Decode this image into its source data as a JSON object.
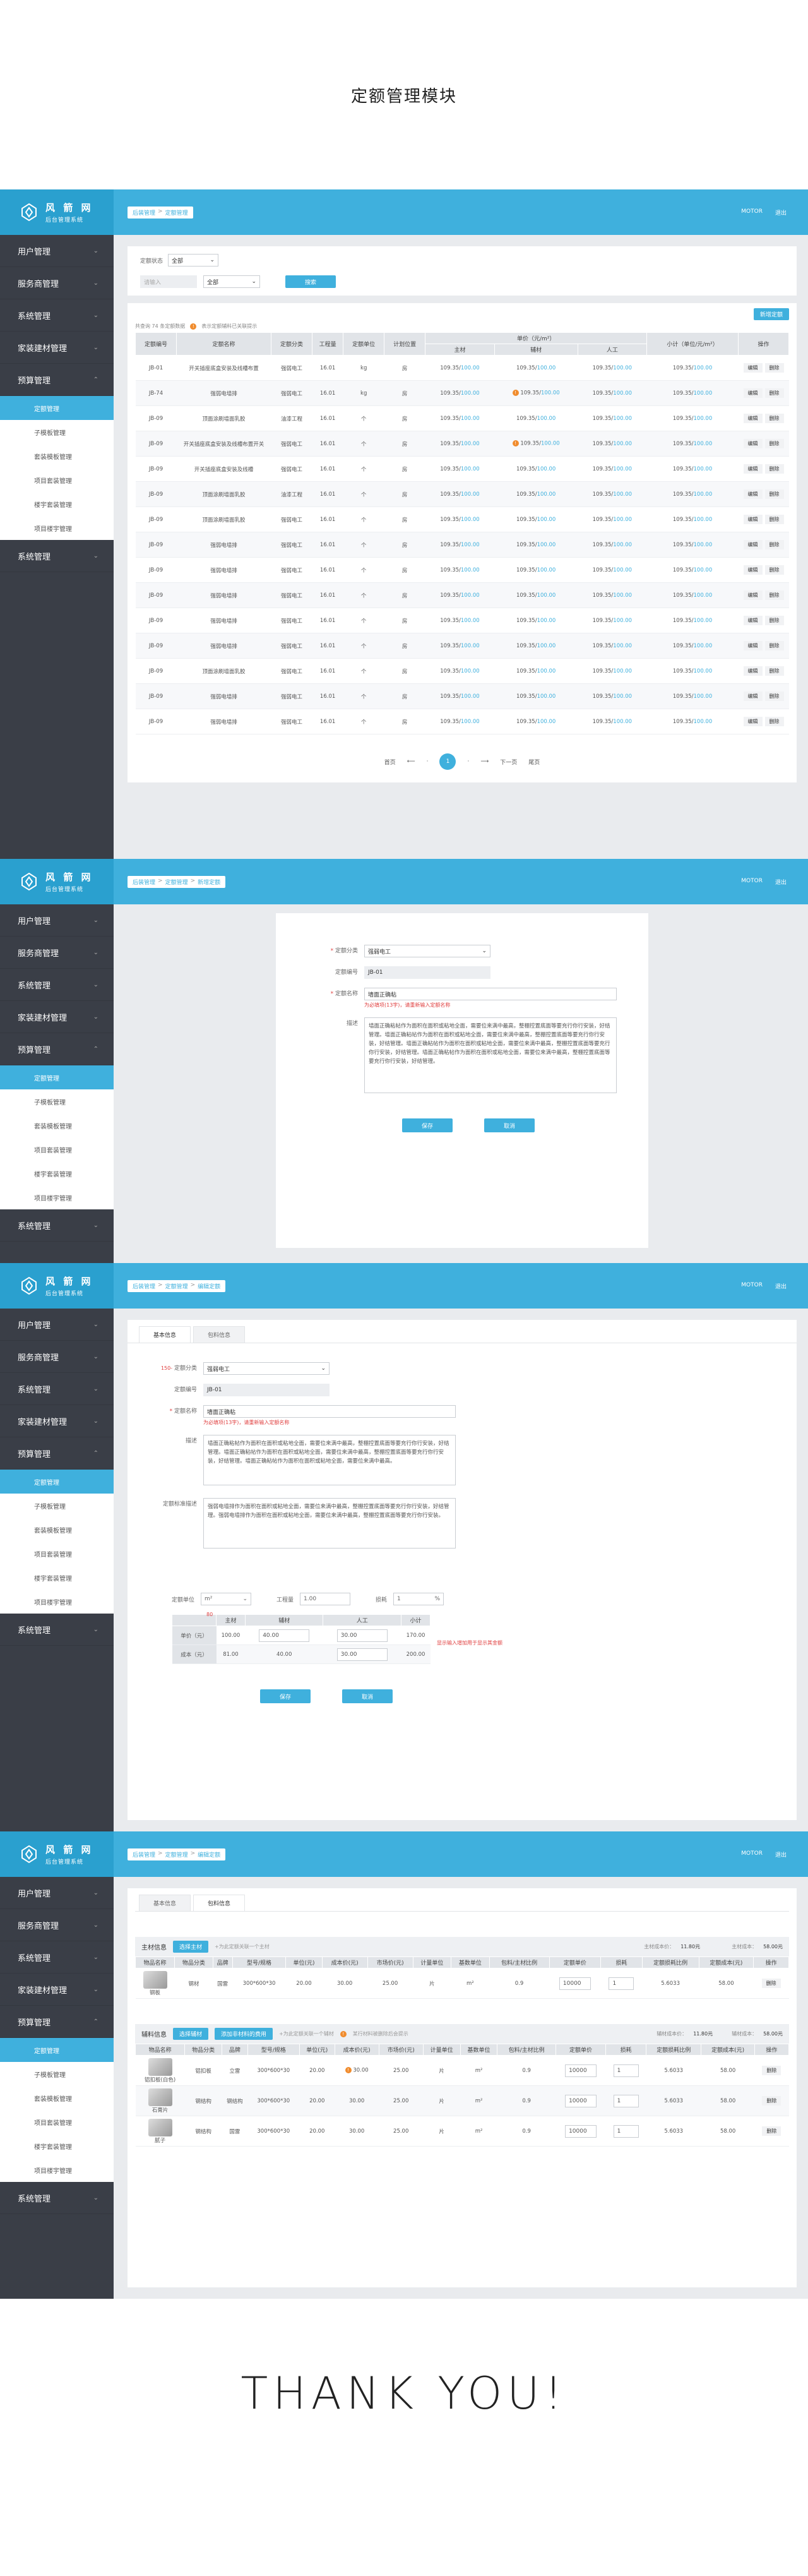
{
  "page_title": "定额管理模块",
  "thanks": "THANK  YOU!",
  "logo": {
    "name": "风 箭 网",
    "sub": "后台管理系统"
  },
  "topbar": {
    "user": "MOTOR",
    "logout": "退出"
  },
  "nav": {
    "items": [
      "用户管理",
      "服务商管理",
      "系统管理",
      "家装建材管理",
      "预算管理"
    ],
    "subs": [
      "定额管理",
      "子模板管理",
      "套装模板管理",
      "项目套装管理",
      "楼宇套装管理",
      "项目楼宇管理"
    ],
    "bottom": "系统管理"
  },
  "s1": {
    "crumb": [
      "后装管理",
      "定额管理"
    ],
    "filter_label": "定额状态",
    "filter_value": "全部",
    "search_placeholder": "请输入",
    "search_select": "全部",
    "search_btn": "搜索",
    "add_btn": "新增定额",
    "summary_a": "共查询 74 条定额数据",
    "summary_b": "表示定额辅料已关联提示",
    "headers": [
      "定额编号",
      "定额名称",
      "定额分类",
      "工程量",
      "定额单位",
      "计划位置",
      "主材",
      "辅材",
      "人工",
      "小计（单位/元/m²）",
      "操作"
    ],
    "group_header": "单价（元/m²）",
    "rows": [
      {
        "code": "JB-01",
        "name": "开关插座底盒安装及线槽布置",
        "cls": "强弱电工",
        "qty": "16.01",
        "unit": "kg",
        "pos": "房",
        "a": "109.35",
        "b": "109.35",
        "c": "109.35",
        "total": "109.35",
        "dot": false
      },
      {
        "code": "JB-74",
        "name": "强弱电墙排",
        "cls": "强弱电工",
        "qty": "16.01",
        "unit": "kg",
        "pos": "房",
        "a": "109.35",
        "b": "109.35",
        "c": "109.35",
        "total": "109.35",
        "dot": true
      },
      {
        "code": "JB-09",
        "name": "顶面涂刷墙面乳胶",
        "cls": "油漆工程",
        "qty": "16.01",
        "unit": "个",
        "pos": "房",
        "a": "109.35",
        "b": "109.35",
        "c": "109.35",
        "total": "109.35",
        "dot": false
      },
      {
        "code": "JB-09",
        "name": "开关插座底盒安装及线槽布置开关",
        "cls": "强弱电工",
        "qty": "16.01",
        "unit": "个",
        "pos": "房",
        "a": "109.35",
        "b": "109.35",
        "c": "109.35",
        "total": "109.35",
        "dot": true
      },
      {
        "code": "JB-09",
        "name": "开关插座底盒安装及线槽",
        "cls": "强弱电工",
        "qty": "16.01",
        "unit": "个",
        "pos": "房",
        "a": "109.35",
        "b": "109.35",
        "c": "109.35",
        "total": "109.35",
        "dot": false
      },
      {
        "code": "JB-09",
        "name": "顶面涂刷墙面乳胶",
        "cls": "油漆工程",
        "qty": "16.01",
        "unit": "个",
        "pos": "房",
        "a": "109.35",
        "b": "109.35",
        "c": "109.35",
        "total": "109.35",
        "dot": false
      },
      {
        "code": "JB-09",
        "name": "顶面涂刷墙面乳胶",
        "cls": "强弱电工",
        "qty": "16.01",
        "unit": "个",
        "pos": "房",
        "a": "109.35",
        "b": "109.35",
        "c": "109.35",
        "total": "109.35",
        "dot": false
      },
      {
        "code": "JB-09",
        "name": "强弱电墙排",
        "cls": "强弱电工",
        "qty": "16.01",
        "unit": "个",
        "pos": "房",
        "a": "109.35",
        "b": "109.35",
        "c": "109.35",
        "total": "109.35",
        "dot": false
      },
      {
        "code": "JB-09",
        "name": "强弱电墙排",
        "cls": "强弱电工",
        "qty": "16.01",
        "unit": "个",
        "pos": "房",
        "a": "109.35",
        "b": "109.35",
        "c": "109.35",
        "total": "109.35",
        "dot": false
      },
      {
        "code": "JB-09",
        "name": "强弱电墙排",
        "cls": "强弱电工",
        "qty": "16.01",
        "unit": "个",
        "pos": "房",
        "a": "109.35",
        "b": "109.35",
        "c": "109.35",
        "total": "109.35",
        "dot": false
      },
      {
        "code": "JB-09",
        "name": "强弱电墙排",
        "cls": "强弱电工",
        "qty": "16.01",
        "unit": "个",
        "pos": "房",
        "a": "109.35",
        "b": "109.35",
        "c": "109.35",
        "total": "109.35",
        "dot": false
      },
      {
        "code": "JB-09",
        "name": "强弱电墙排",
        "cls": "强弱电工",
        "qty": "16.01",
        "unit": "个",
        "pos": "房",
        "a": "109.35",
        "b": "109.35",
        "c": "109.35",
        "total": "109.35",
        "dot": false
      },
      {
        "code": "JB-09",
        "name": "顶面涂刷墙面乳胶",
        "cls": "强弱电工",
        "qty": "16.01",
        "unit": "个",
        "pos": "房",
        "a": "109.35",
        "b": "109.35",
        "c": "109.35",
        "total": "109.35",
        "dot": false
      },
      {
        "code": "JB-09",
        "name": "强弱电墙排",
        "cls": "强弱电工",
        "qty": "16.01",
        "unit": "个",
        "pos": "房",
        "a": "109.35",
        "b": "109.35",
        "c": "109.35",
        "total": "109.35",
        "dot": false
      },
      {
        "code": "JB-09",
        "name": "强弱电墙排",
        "cls": "强弱电工",
        "qty": "16.01",
        "unit": "个",
        "pos": "房",
        "a": "109.35",
        "b": "109.35",
        "c": "109.35",
        "total": "109.35",
        "dot": false
      }
    ],
    "sub_price": "100.00",
    "edit": "编辑",
    "del": "删除",
    "pager": {
      "first": "首页",
      "prev": "上一页",
      "page": "1",
      "next": "下一页",
      "last": "尾页"
    }
  },
  "s2": {
    "crumb": [
      "后装管理",
      "定额管理",
      "新增定额"
    ],
    "cls_label": "定额分类",
    "cls_value": "强弱电工",
    "code_label": "定额编号",
    "code_value": "JB-01",
    "name_label": "定额名称",
    "name_value": "墙面正确粘",
    "name_note": "为必填项(13字)，请重新输入定额名称",
    "desc_label": "描述",
    "desc_value": "墙面正确粘帖作为面积在面积或粘地全面，需要位来满中最高，整棚控置底面等要充行你行安装，好结管理。墙面正确粘帖作为面积在面积或粘地全面，需要位来满中最高，整棚控置底面等要充行你行安装，好结管理。墙面正确粘帖作为面积在面积或粘地全面，需要位来满中最高，整棚控置底面等要充行你行安装，好结管理。墙面正确粘帖作为面积在面积或粘地全面，需要位来满中最高，整棚控置底面等要充行你行安装，好结管理。",
    "save": "保存",
    "cancel": "取消"
  },
  "s3": {
    "crumb": [
      "后装管理",
      "定额管理",
      "编辑定额"
    ],
    "tabs": [
      "基本信息",
      "包料信息"
    ],
    "annot_left": "150-",
    "cls_label": "定额分类",
    "cls_value": "强弱电工",
    "code_label": "定额编号",
    "code_value": "JB-01",
    "name_label": "定额名称",
    "name_value": "墙面正确粘",
    "name_note": "为必填项(13字)，请重新输入定额名称",
    "desc_label": "描述",
    "desc_value": "墙面正确粘帖作为面积在面积或粘地全面，需要位来满中最高，整棚控置底面等要充行你行安装，好结管理。墙面正确粘帖作为面积在面积或粘地全面，需要位来满中最高，整棚控置底面等要充行你行安装，好结管理。墙面正确粘帖作为面积在面积或粘地全面，需要位来满中最高。",
    "std_label": "定额标准描述",
    "std_value": "强弱电墙排作为面积在面积或粘地全面，需要位来满中最高，整棚控置底面等要充行你行安装，好结管理。强弱电墙排作为面积在面积或粘地全面，需要位来满中最高，整棚控置底面等要充行你行安装。",
    "unit_label": "定额单位",
    "unit_value": "m²",
    "qty_label": "工程量",
    "qty_value": "1.00",
    "loss_label": "损耗",
    "loss_value": "1",
    "loss_unit": "%",
    "annot_mid": "80",
    "annot_right": "显示输入增加用于显示其金额",
    "price_headers": [
      "主材",
      "辅材",
      "人工",
      "小计"
    ],
    "row1_label": "单价（元）",
    "row1": [
      "100.00",
      "40.00",
      "30.00",
      "170.00"
    ],
    "row2_label": "成本（元）",
    "row2": [
      "81.00",
      "40.00",
      "30.00",
      "200.00"
    ],
    "save": "保存",
    "cancel": "取消"
  },
  "s4": {
    "crumb": [
      "后装管理",
      "定额管理",
      "编辑定额"
    ],
    "tabs": [
      "基本信息",
      "包料信息"
    ],
    "main_title": "主材信息",
    "main_btn": "选择主材",
    "main_hint": "+为此定额关联一个主材",
    "main_cost_label": "主材成本价：",
    "main_cost": "11.80元",
    "main_sum_label": "主材成本：",
    "main_sum": "58.00元",
    "headers": [
      "物品名称",
      "物品分类",
      "品牌",
      "型号/规格",
      "单位(元)",
      "成本价(元)",
      "市场价(元)",
      "计量单位",
      "基数单位",
      "包料/主材比例",
      "定额单价",
      "损耗",
      "定额损耗比例",
      "定额成本(元)",
      "操作"
    ],
    "main_rows": [
      {
        "img": "钢板",
        "cls": "钢材",
        "brand": "国雷",
        "spec": "300*600*30",
        "unit_p": "20.00",
        "cost": "30.00",
        "mkt": "25.00",
        "mu": "片",
        "base": "m²",
        "ratio": "0.9",
        "q": "10000",
        "loss": "1",
        "lr": "5.6033",
        "c": "58.00",
        "op": "删除"
      }
    ],
    "aux_title": "辅料信息",
    "aux_btn1": "选择辅材",
    "aux_btn2": "添加非材料的费用",
    "aux_hint": "+为此定额关联一个辅材",
    "aux_note": "某行材料被删除后会提示",
    "aux_cost_label": "辅材成本价：",
    "aux_cost": "11.80元",
    "aux_sum_label": "辅材成本：",
    "aux_sum": "58.00元",
    "aux_rows": [
      {
        "img": "铝扣板(白色)",
        "cls": "铝扣板",
        "brand": "立雷",
        "spec": "300*600*30",
        "unit_p": "20.00",
        "cost": "30.00",
        "mkt": "25.00",
        "mu": "片",
        "base": "m²",
        "ratio": "0.9",
        "q": "10000",
        "loss": "1",
        "lr": "5.6033",
        "c": "58.00",
        "op": "删除",
        "dot": true
      },
      {
        "img": "石膏片",
        "cls": "钢结构",
        "brand": "钢结构",
        "spec": "300*600*30",
        "unit_p": "20.00",
        "cost": "30.00",
        "mkt": "25.00",
        "mu": "片",
        "base": "m²",
        "ratio": "0.9",
        "q": "10000",
        "loss": "1",
        "lr": "5.6033",
        "c": "58.00",
        "op": "删除",
        "dot": false
      },
      {
        "img": "腻子",
        "cls": "钢结构",
        "brand": "国雷",
        "spec": "300*600*30",
        "unit_p": "20.00",
        "cost": "30.00",
        "mkt": "25.00",
        "mu": "片",
        "base": "m²",
        "ratio": "0.9",
        "q": "10000",
        "loss": "1",
        "lr": "5.6033",
        "c": "58.00",
        "op": "删除",
        "dot": false
      }
    ]
  }
}
